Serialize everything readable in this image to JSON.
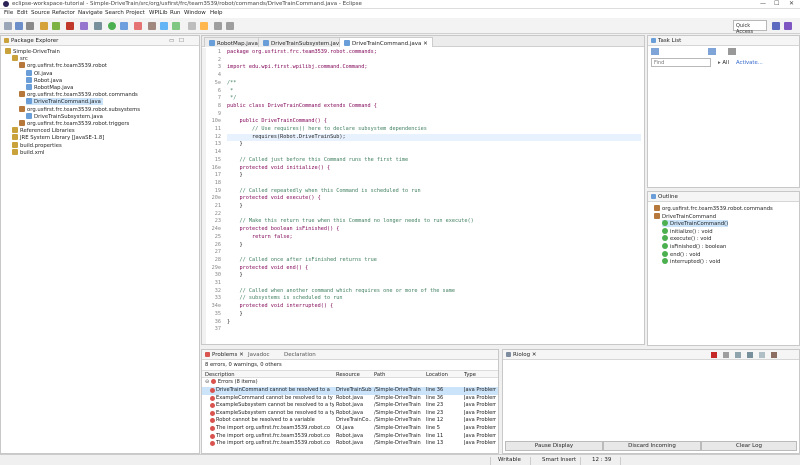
{
  "window": {
    "title": "eclipse-workspace-tutorial - Simple-DriveTrain/src/org/usfirst/frc/team3539/robot/commands/DriveTrainCommand.java - Eclipse",
    "controls": [
      "—",
      "☐",
      "✕"
    ]
  },
  "menu": [
    "File",
    "Edit",
    "Source",
    "Refactor",
    "Navigate",
    "Search",
    "Project",
    "WPILib",
    "Run",
    "Window",
    "Help"
  ],
  "toolbar": {
    "quick_access": "Quick Access"
  },
  "package_explorer": {
    "title": "Package Explorer",
    "items": [
      {
        "label": "Simple-DriveTrain",
        "level": 0
      },
      {
        "label": "src",
        "level": 1
      },
      {
        "label": "org.usfirst.frc.team3539.robot",
        "level": 2
      },
      {
        "label": "OI.java",
        "level": 3
      },
      {
        "label": "Robot.java",
        "level": 3
      },
      {
        "label": "RobotMap.java",
        "level": 3
      },
      {
        "label": "org.usfirst.frc.team3539.robot.commands",
        "level": 2
      },
      {
        "label": "DriveTrainCommand.java",
        "level": 3,
        "selected": true
      },
      {
        "label": "org.usfirst.frc.team3539.robot.subsystems",
        "level": 2
      },
      {
        "label": "DriveTrainSubsystem.java",
        "level": 3
      },
      {
        "label": "org.usfirst.frc.team3539.robot.triggers",
        "level": 2
      },
      {
        "label": "Referenced Libraries",
        "level": 1
      },
      {
        "label": "JRE System Library [JavaSE-1.8]",
        "level": 1
      },
      {
        "label": "build.properties",
        "level": 1
      },
      {
        "label": "build.xml",
        "level": 1
      }
    ]
  },
  "editor": {
    "tabs": [
      "RobotMap.java",
      "DriveTrainSubsystem.java",
      "DriveTrainCommand.java"
    ],
    "active_tab": 2,
    "lines": [
      "package org.usfirst.frc.team3539.robot.commands;",
      "",
      "import edu.wpi.first.wpilibj.command.Command;",
      "",
      "/**",
      " *",
      " */",
      "public class DriveTrainCommand extends Command {",
      "",
      "    public DriveTrainCommand() {",
      "        // Use requires() here to declare subsystem dependencies",
      "        requires(Robot.DriveTrainSub);",
      "    }",
      "",
      "    // Called just before this Command runs the first time",
      "    protected void initialize() {",
      "    }",
      "",
      "    // Called repeatedly when this Command is scheduled to run",
      "    protected void execute() {",
      "    }",
      "",
      "    // Make this return true when this Command no longer needs to run execute()",
      "    protected boolean isFinished() {",
      "        return false;",
      "    }",
      "",
      "    // Called once after isFinished returns true",
      "    protected void end() {",
      "    }",
      "",
      "    // Called when another command which requires one or more of the same",
      "    // subsystems is scheduled to run",
      "    protected void interrupted() {",
      "    }",
      "}",
      ""
    ],
    "line_numbers": [
      "1",
      "2",
      "3",
      "4",
      "5⊖",
      "6",
      "7",
      "8",
      "9",
      "10⊖",
      "11",
      "12",
      "13",
      "14",
      "15",
      "16⊖",
      "17",
      "18",
      "19",
      "20⊖",
      "21",
      "22",
      "23",
      "24⊖",
      "25",
      "26",
      "27",
      "28",
      "29⊖",
      "30",
      "31",
      "32",
      "33",
      "34⊖",
      "35",
      "36",
      "37"
    ]
  },
  "task_list": {
    "title": "Task List",
    "find_placeholder": "Find",
    "all_label": "All",
    "activate_label": "Activate..."
  },
  "outline": {
    "title": "Outline",
    "items": [
      {
        "label": "org.usfirst.frc.team3539.robot.commands",
        "level": 0
      },
      {
        "label": "DriveTrainCommand",
        "level": 0
      },
      {
        "label": "DriveTrainCommand()",
        "level": 1,
        "selected": true
      },
      {
        "label": "initialize() : void",
        "level": 1
      },
      {
        "label": "execute() : void",
        "level": 1
      },
      {
        "label": "isFinished() : boolean",
        "level": 1
      },
      {
        "label": "end() : void",
        "level": 1
      },
      {
        "label": "interrupted() : void",
        "level": 1
      }
    ]
  },
  "problems": {
    "tabs": [
      "Problems",
      "Javadoc",
      "Declaration"
    ],
    "summary": "8 errors, 0 warnings, 0 others",
    "columns": [
      "Description",
      "Resource",
      "Path",
      "Location",
      "Type"
    ],
    "group": "Errors (8 items)",
    "rows": [
      [
        "DriveTrainCommand cannot be resolved to a",
        "DriveTrainSub...",
        "/Simple-DriveTrain",
        "line 36",
        "Java Problem"
      ],
      [
        "ExampleCommand cannot be resolved to a ty",
        "Robot.java",
        "/Simple-DriveTrain",
        "line 36",
        "Java Problem"
      ],
      [
        "ExampleSubsystem cannot be resolved to a ty",
        "Robot.java",
        "/Simple-DriveTrain",
        "line 23",
        "Java Problem"
      ],
      [
        "ExampleSubsystem cannot be resolved to a ty",
        "Robot.java",
        "/Simple-DriveTrain",
        "line 23",
        "Java Problem"
      ],
      [
        "Robot cannot be resolved to a variable",
        "DriveTrainCo...",
        "/Simple-DriveTrain",
        "line 12",
        "Java Problem"
      ],
      [
        "The import org.usfirst.frc.team3539.robot.co",
        "OI.java",
        "/Simple-DriveTrain",
        "line 5",
        "Java Problem"
      ],
      [
        "The import org.usfirst.frc.team3539.robot.co",
        "Robot.java",
        "/Simple-DriveTrain",
        "line 11",
        "Java Problem"
      ],
      [
        "The import org.usfirst.frc.team3539.robot.co",
        "Robot.java",
        "/Simple-DriveTrain",
        "line 13",
        "Java Problem"
      ]
    ]
  },
  "riolog": {
    "title": "Riolog",
    "buttons": [
      "Pause Display",
      "Discard Incoming",
      "Clear Log"
    ]
  },
  "statusbar": {
    "writable": "Writable",
    "insert_mode": "Smart Insert",
    "position": "12 : 39"
  }
}
